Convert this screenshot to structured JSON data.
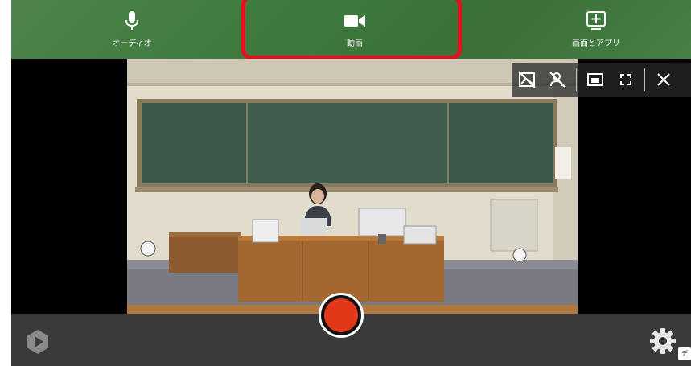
{
  "toolbar": {
    "tabs": [
      {
        "label": "オーディオ",
        "icon": "microphone-icon"
      },
      {
        "label": "動画",
        "icon": "video-camera-icon"
      },
      {
        "label": "画面とアプリ",
        "icon": "screen-share-icon"
      }
    ],
    "selected_tab": "動画",
    "accent_color": "#3e7a3d",
    "highlight_color": "#e8101c"
  },
  "camera": {
    "preview": "classroom-webcam-preview"
  },
  "overlay_controls": [
    {
      "icon": "hide-background-icon"
    },
    {
      "icon": "hide-person-icon"
    },
    {
      "icon": "picture-in-picture-icon"
    },
    {
      "icon": "fullscreen-icon"
    },
    {
      "icon": "close-icon"
    }
  ],
  "bottom": {
    "record_color": "#e23818",
    "logo_icon": "app-logo-icon",
    "settings_icon": "gear-icon",
    "corner_tag": "デ"
  }
}
